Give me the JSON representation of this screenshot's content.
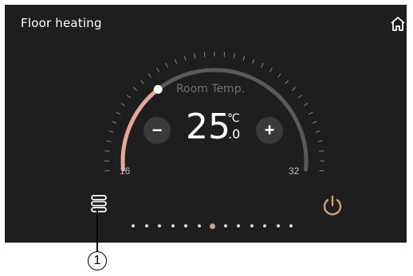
{
  "header": {
    "title": "Floor heating",
    "home_icon": "home-icon"
  },
  "thermostat": {
    "label": "Room Temp.",
    "setpoint_int": "25",
    "setpoint_dec": ".0",
    "unit": "℃",
    "min_label": "16",
    "max_label": "32",
    "min": 16,
    "max": 32,
    "level_fraction": 0.3,
    "decrease_label": "−",
    "increase_label": "+",
    "colors": {
      "active_arc": "#e8a69a",
      "inactive_arc": "#5a5a5a",
      "accent": "#c8a47a"
    }
  },
  "controls": {
    "menu_icon": "menu-icon",
    "power_icon": "power-icon",
    "page_count": 13,
    "active_page": 7
  },
  "annotation": {
    "callout_number": "1"
  }
}
